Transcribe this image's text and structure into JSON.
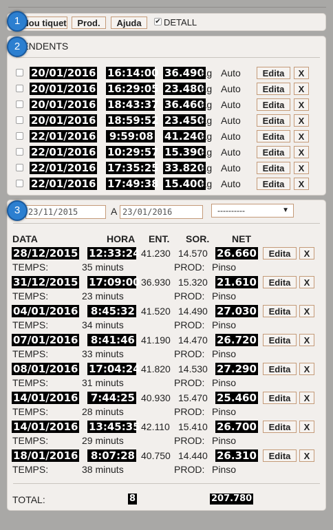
{
  "toolbar": {
    "new_ticket_label": "Nou tiquet",
    "prod_label": "Prod.",
    "help_label": "Ajuda",
    "detail_label": "DETALL",
    "detail_checked": true
  },
  "pending": {
    "title": "PENDENTS",
    "rows": [
      {
        "date": "20/01/2016",
        "time": "16:14:00",
        "weight": "36.490",
        "unit": "Kg",
        "mode": "Auto",
        "edit": "Edita",
        "del": "X"
      },
      {
        "date": "20/01/2016",
        "time": "16:29:05",
        "weight": "23.480",
        "unit": "Kg",
        "mode": "Auto",
        "edit": "Edita",
        "del": "X"
      },
      {
        "date": "20/01/2016",
        "time": "18:43:37",
        "weight": "36.460",
        "unit": "Kg",
        "mode": "Auto",
        "edit": "Edita",
        "del": "X"
      },
      {
        "date": "20/01/2016",
        "time": "18:59:52",
        "weight": "23.450",
        "unit": "Kg",
        "mode": "Auto",
        "edit": "Edita",
        "del": "X"
      },
      {
        "date": "22/01/2016",
        "time": "9:59:08",
        "weight": "41.240",
        "unit": "Kg",
        "mode": "Auto",
        "edit": "Edita",
        "del": "X"
      },
      {
        "date": "22/01/2016",
        "time": "10:29:57",
        "weight": "15.390",
        "unit": "Kg",
        "mode": "Auto",
        "edit": "Edita",
        "del": "X"
      },
      {
        "date": "22/01/2016",
        "time": "17:35:25",
        "weight": "33.820",
        "unit": "Kg",
        "mode": "Auto",
        "edit": "Edita",
        "del": "X"
      },
      {
        "date": "22/01/2016",
        "time": "17:49:38",
        "weight": "15.400",
        "unit": "Kg",
        "mode": "Auto",
        "edit": "Edita",
        "del": "X"
      }
    ]
  },
  "filter": {
    "from_value": "23/11/2015",
    "to_label": "A",
    "to_value": "23/01/2016",
    "select_value": "----------"
  },
  "tickets": {
    "headers": {
      "data": "DATA",
      "hora": "HORA",
      "ent": "ENT.",
      "sor": "SOR.",
      "net": "NET"
    },
    "temps_label": "TEMPS:",
    "prod_label": "PROD:",
    "edit_label": "Edita",
    "del_label": "X",
    "rows": [
      {
        "date": "28/12/2015",
        "time": "12:33:24",
        "ent": "41.230",
        "sor": "14.570",
        "net": "26.660",
        "temps": "35 minuts",
        "prod": "Pinso"
      },
      {
        "date": "31/12/2015",
        "time": "17:09:00",
        "ent": "36.930",
        "sor": "15.320",
        "net": "21.610",
        "temps": "23 minuts",
        "prod": "Pinso"
      },
      {
        "date": "04/01/2016",
        "time": "8:45:32",
        "ent": "41.520",
        "sor": "14.490",
        "net": "27.030",
        "temps": "34 minuts",
        "prod": "Pinso"
      },
      {
        "date": "07/01/2016",
        "time": "8:41:46",
        "ent": "41.190",
        "sor": "14.470",
        "net": "26.720",
        "temps": "33 minuts",
        "prod": "Pinso"
      },
      {
        "date": "08/01/2016",
        "time": "17:04:24",
        "ent": "41.820",
        "sor": "14.530",
        "net": "27.290",
        "temps": "31 minuts",
        "prod": "Pinso"
      },
      {
        "date": "14/01/2016",
        "time": "7:44:25",
        "ent": "40.930",
        "sor": "15.470",
        "net": "25.460",
        "temps": "28 minuts",
        "prod": "Pinso"
      },
      {
        "date": "14/01/2016",
        "time": "13:45:35",
        "ent": "42.110",
        "sor": "15.410",
        "net": "26.700",
        "temps": "29 minuts",
        "prod": "Pinso"
      },
      {
        "date": "18/01/2016",
        "time": "8:07:28",
        "ent": "40.750",
        "sor": "14.440",
        "net": "26.310",
        "temps": "38 minuts",
        "prod": "Pinso"
      }
    ],
    "total_label": "TOTAL:",
    "total_count": "8",
    "total_net": "207.780"
  },
  "badges": [
    "1",
    "2",
    "3"
  ],
  "colors": {
    "badge": "#2c7fd0",
    "highlight": "#000000",
    "panel": "#f2efec",
    "button_border": "#c49a78"
  }
}
